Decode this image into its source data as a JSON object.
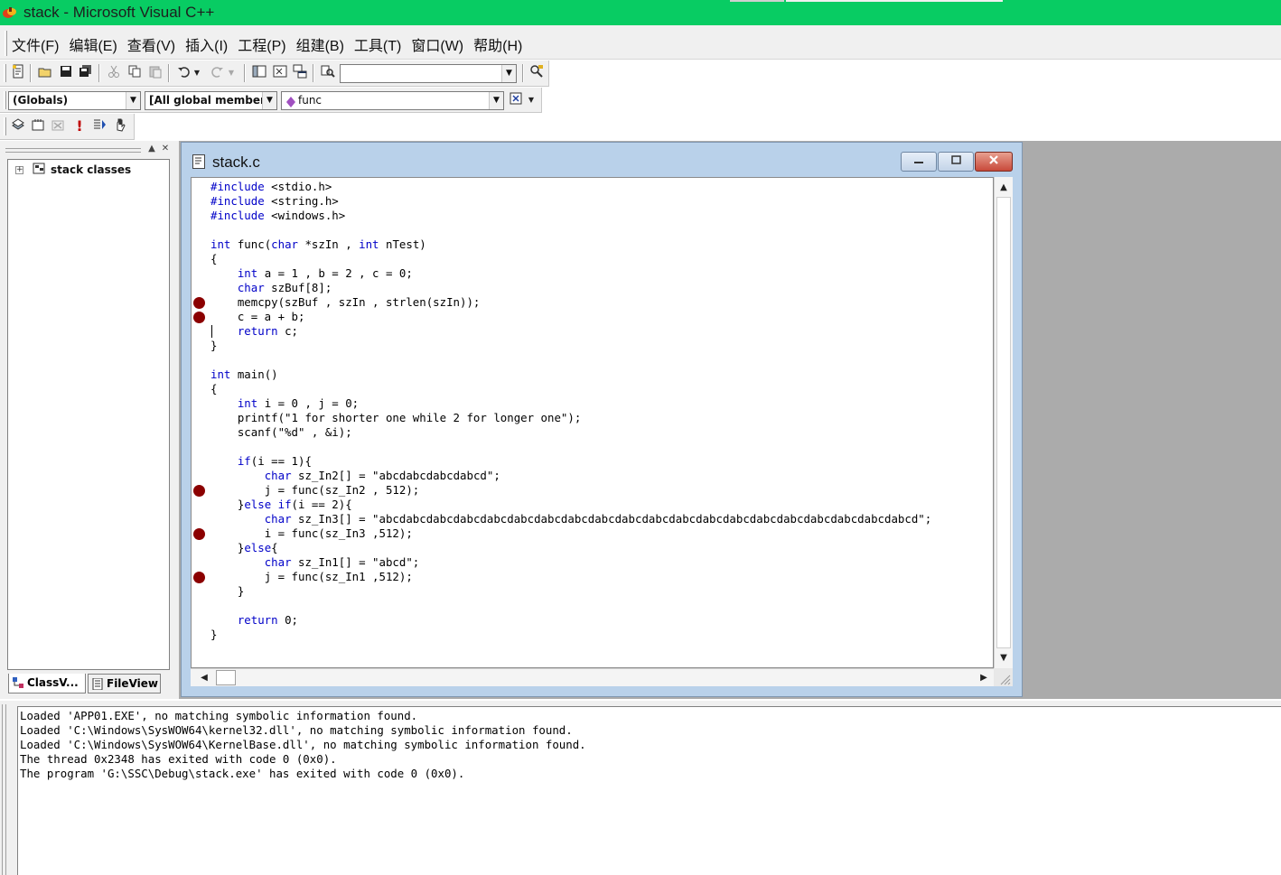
{
  "window": {
    "title": "stack - Microsoft Visual C++",
    "titlebar_color": "#08cc63",
    "app_icon": "visual-cpp-icon"
  },
  "menubar": {
    "items": [
      "文件(F)",
      "编辑(E)",
      "查看(V)",
      "插入(I)",
      "工程(P)",
      "组建(B)",
      "工具(T)",
      "窗口(W)",
      "帮助(H)"
    ]
  },
  "toolbar_standard": {
    "buttons": [
      "new-text-file-icon",
      "open-folder-icon",
      "save-icon",
      "save-all-icon",
      "cut-icon",
      "copy-icon",
      "paste-icon",
      "undo-icon",
      "redo-icon",
      "workspace-icon",
      "output-window-icon",
      "window-list-icon",
      "find-in-files-icon",
      "search-icon"
    ],
    "find_combo_value": ""
  },
  "wizardbar": {
    "class_combo": "(Globals)",
    "filter_combo": "[All global member",
    "member_combo": "func",
    "member_icon": "function-diamond-icon",
    "action_icon": "wizard-action-icon"
  },
  "toolbar_build": {
    "buttons": [
      "compile-icon",
      "build-icon",
      "stop-build-icon",
      "execute-icon",
      "go-icon",
      "insert-breakpoint-icon"
    ]
  },
  "class_panel": {
    "tree_root": "stack classes",
    "tabs": [
      "ClassV...",
      "FileView"
    ],
    "active_tab": "ClassV..."
  },
  "editor": {
    "file_title": "stack.c",
    "keyword_color": "#0000c8",
    "breakpoint_color": "#8b0000",
    "lines": [
      {
        "indent": "",
        "kw": "#include",
        "rest": " <stdio.h>",
        "bp": false
      },
      {
        "indent": "",
        "kw": "#include",
        "rest": " <string.h>",
        "bp": false
      },
      {
        "indent": "",
        "kw": "#include",
        "rest": " <windows.h>",
        "bp": false
      },
      {
        "indent": "",
        "kw": "",
        "rest": "",
        "bp": false
      },
      {
        "indent": "",
        "kw": "int",
        "rest": " func(",
        "kw2": "char",
        "rest2": " *szIn , ",
        "kw3": "int",
        "rest3": " nTest)",
        "bp": false
      },
      {
        "indent": "",
        "kw": "",
        "rest": "{",
        "bp": false
      },
      {
        "indent": "    ",
        "kw": "int",
        "rest": " a = 1 , b = 2 , c = 0;",
        "bp": false
      },
      {
        "indent": "    ",
        "kw": "char",
        "rest": " szBuf[8];",
        "bp": false
      },
      {
        "indent": "    ",
        "kw": "",
        "rest": "memcpy(szBuf , szIn , strlen(szIn));",
        "bp": true
      },
      {
        "indent": "    ",
        "kw": "",
        "rest": "c = a + b;",
        "bp": true
      },
      {
        "indent": "    ",
        "kw": "return",
        "rest": " c;",
        "bp": false
      },
      {
        "indent": "",
        "kw": "",
        "rest": "}",
        "bp": false
      },
      {
        "indent": "",
        "kw": "",
        "rest": "",
        "bp": false
      },
      {
        "indent": "",
        "kw": "int",
        "rest": " main()",
        "bp": false
      },
      {
        "indent": "",
        "kw": "",
        "rest": "{",
        "bp": false
      },
      {
        "indent": "    ",
        "kw": "int",
        "rest": " i = 0 , j = 0;",
        "bp": false
      },
      {
        "indent": "    ",
        "kw": "",
        "rest": "printf(\"1 for shorter one while 2 for longer one\");",
        "bp": false
      },
      {
        "indent": "    ",
        "kw": "",
        "rest": "scanf(\"%d\" , &i);",
        "bp": false
      },
      {
        "indent": "",
        "kw": "",
        "rest": "",
        "bp": false
      },
      {
        "indent": "    ",
        "kw": "if",
        "rest": "(i == 1){",
        "bp": false
      },
      {
        "indent": "        ",
        "kw": "char",
        "rest": " sz_In2[] = \"abcdabcdabcdabcd\";",
        "bp": false
      },
      {
        "indent": "        ",
        "kw": "",
        "rest": "j = func(sz_In2 , 512);",
        "bp": true
      },
      {
        "indent": "    ",
        "kw": "",
        "rest": "}",
        "kw2": "else",
        "rest2": " ",
        "kw3": "if",
        "rest3": "(i == 2){",
        "bp": false
      },
      {
        "indent": "        ",
        "kw": "char",
        "rest": " sz_In3[] = \"abcdabcdabcdabcdabcdabcdabcdabcdabcdabcdabcdabcdabcdabcdabcdabcdabcdabcdabcdabcd\";",
        "bp": false
      },
      {
        "indent": "        ",
        "kw": "",
        "rest": "i = func(sz_In3 ,512);",
        "bp": true
      },
      {
        "indent": "    ",
        "kw": "",
        "rest": "}",
        "kw2": "else",
        "rest2": "{",
        "bp": false
      },
      {
        "indent": "        ",
        "kw": "char",
        "rest": " sz_In1[] = \"abcd\";",
        "bp": false
      },
      {
        "indent": "        ",
        "kw": "",
        "rest": "j = func(sz_In1 ,512);",
        "bp": true
      },
      {
        "indent": "    ",
        "kw": "",
        "rest": "}",
        "bp": false
      },
      {
        "indent": "",
        "kw": "",
        "rest": "",
        "bp": false
      },
      {
        "indent": "    ",
        "kw": "return",
        "rest": " 0;",
        "bp": false
      },
      {
        "indent": "",
        "kw": "",
        "rest": "}",
        "bp": false
      }
    ],
    "caret_line": 10
  },
  "output": {
    "lines": [
      "Loaded 'APP01.EXE', no matching symbolic information found.",
      "Loaded 'C:\\Windows\\SysWOW64\\kernel32.dll', no matching symbolic information found.",
      "Loaded 'C:\\Windows\\SysWOW64\\KernelBase.dll', no matching symbolic information found.",
      "The thread 0x2348 has exited with code 0 (0x0).",
      "The program 'G:\\SSC\\Debug\\stack.exe' has exited with code 0 (0x0)."
    ]
  }
}
